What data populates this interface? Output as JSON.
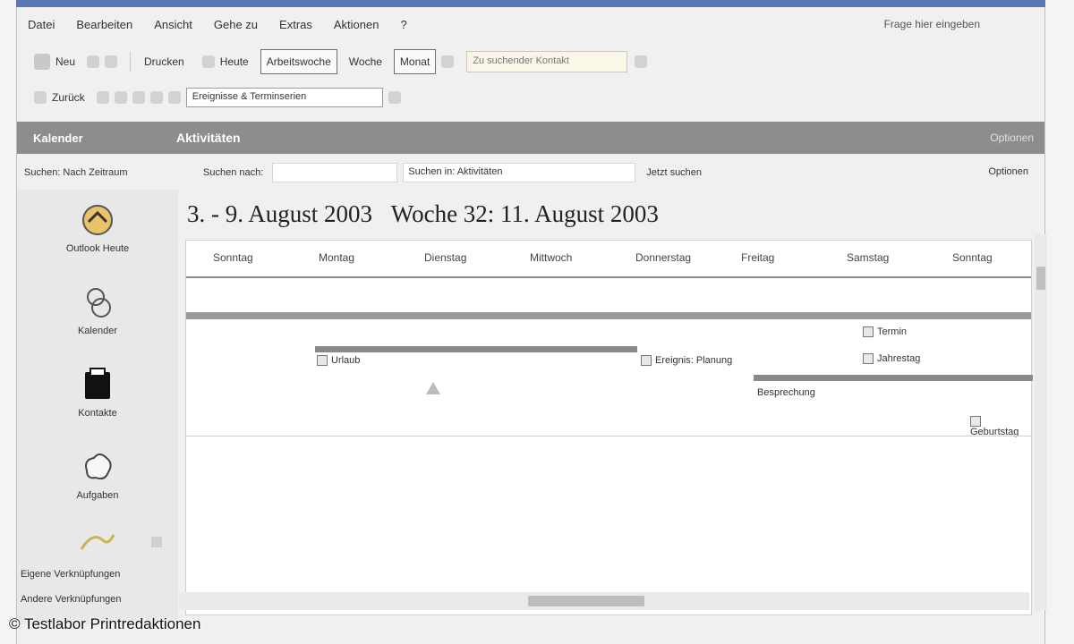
{
  "menu": {
    "items": [
      "Datei",
      "Bearbeiten",
      "Ansicht",
      "Gehe zu",
      "Extras",
      "Aktionen",
      "?"
    ],
    "help_placeholder": "Frage hier eingeben"
  },
  "toolbar1": {
    "new_label": "Neu",
    "print_label": "Drucken",
    "today_label": "Heute",
    "workweek_label": "Arbeitswoche",
    "week_label": "Woche",
    "month_label": "Monat",
    "search_placeholder": "Zu suchender Kontakt"
  },
  "toolbar2": {
    "back_label": "Zurück",
    "dropdown_value": "Ereignisse & Terminserien"
  },
  "navbar": {
    "left_label": "Kalender",
    "title": "Aktivitäten",
    "right_label": "Optionen"
  },
  "filterbar": {
    "label": "Suchen: Nach Zeitraum",
    "field1_label": "Suchen nach:",
    "field2_label": "Suchen in: Aktivitäten",
    "field3_label": "Jetzt suchen",
    "right_label": "Optionen"
  },
  "sidebar": {
    "items": [
      {
        "label": "Outlook Heute",
        "icon": "outlook-today-icon"
      },
      {
        "label": "Kalender",
        "icon": "calendar-icon"
      },
      {
        "label": "Kontakte",
        "icon": "contacts-icon"
      },
      {
        "label": "Aufgaben",
        "icon": "tasks-icon"
      }
    ],
    "bottom_link1": "Eigene Verknüpfungen",
    "bottom_link2": "Andere Verknüpfungen"
  },
  "calendar": {
    "date_title": "3. - 9. August 2003",
    "week_title": "Woche 32: 11. August 2003",
    "days": [
      "Sonntag",
      "Montag",
      "Dienstag",
      "Mittwoch",
      "Donnerstag",
      "Freitag",
      "Samstag",
      "Sonntag"
    ],
    "events": [
      {
        "label": "Urlaub"
      },
      {
        "label": "Ereignis: Planung"
      },
      {
        "label": "Besprechung"
      },
      {
        "label": "Termin"
      },
      {
        "label": "Jahrestag"
      },
      {
        "label": "Geburtstag"
      }
    ]
  },
  "footer": {
    "copyright": "© Testlabor Printredaktionen"
  }
}
